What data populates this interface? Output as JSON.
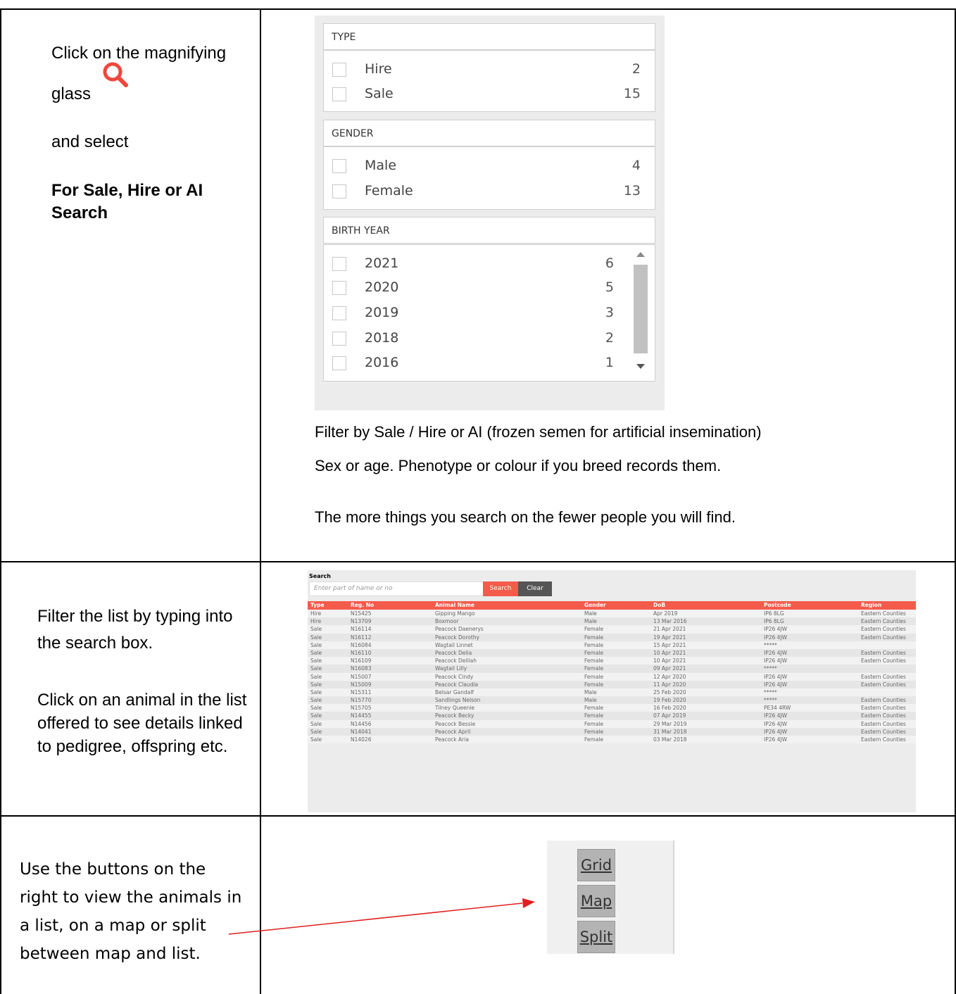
{
  "row1": {
    "instruction_1": "Click on the magnifying",
    "instruction_2": "glass",
    "instruction_3": "and select",
    "instruction_4": "For Sale, Hire or AI",
    "instruction_5": "Search",
    "icon": "search-icon",
    "icon_color": "#f0463c"
  },
  "filter_panel": {
    "type": {
      "title": "TYPE",
      "options": [
        {
          "label": "Hire",
          "count": "2"
        },
        {
          "label": "Sale",
          "count": "15"
        }
      ]
    },
    "gender": {
      "title": "GENDER",
      "options": [
        {
          "label": "Male",
          "count": "4"
        },
        {
          "label": "Female",
          "count": "13"
        }
      ]
    },
    "birth_year": {
      "title": "BIRTH YEAR",
      "options": [
        {
          "label": "2021",
          "count": "6"
        },
        {
          "label": "2020",
          "count": "5"
        },
        {
          "label": "2019",
          "count": "3"
        },
        {
          "label": "2018",
          "count": "2"
        },
        {
          "label": "2016",
          "count": "1"
        }
      ]
    }
  },
  "notes": {
    "line1": "Filter by Sale / Hire or AI (frozen semen for artificial insemination)",
    "line2": "Sex or age. Phenotype or colour if you breed records them.",
    "line3": "The more things you search on the fewer people you will find."
  },
  "row2": {
    "text1a": "Filter the list by typing into",
    "text1b": "the search box.",
    "text2a": "Click on an animal in the list",
    "text2b": "offered to see details linked",
    "text2c": "to pedigree, offspring etc."
  },
  "search": {
    "label": "Search",
    "placeholder": "Enter part of name or no",
    "search_button": "Search",
    "clear_button": "Clear",
    "accent": "#f45b4b"
  },
  "grid": {
    "columns": [
      "Type",
      "Reg. No",
      "Animal Name",
      "Gender",
      "DoB",
      "Postcode",
      "Region"
    ],
    "rows": [
      [
        "Hire",
        "N15425",
        "Gipping Mango",
        "Male",
        "Apr 2019",
        "IP6 8LG",
        "Eastern Counties"
      ],
      [
        "Hire",
        "N13709",
        "Boxmoor",
        "Male",
        "13 Mar 2016",
        "IP6 8LG",
        "Eastern Counties"
      ],
      [
        "Sale",
        "N16114",
        "Peacock Daenerys",
        "Female",
        "21 Apr 2021",
        "IP26 4JW",
        "Eastern Counties"
      ],
      [
        "Sale",
        "N16112",
        "Peacock Dorothy",
        "Female",
        "19 Apr 2021",
        "IP26 4JW",
        "Eastern Counties"
      ],
      [
        "Sale",
        "N16084",
        "Wagtail Linnet",
        "Female",
        "15 Apr 2021",
        "*****",
        ""
      ],
      [
        "Sale",
        "N16110",
        "Peacock Delia",
        "Female",
        "10 Apr 2021",
        "IP26 4JW",
        "Eastern Counties"
      ],
      [
        "Sale",
        "N16109",
        "Peacock Delilah",
        "Female",
        "10 Apr 2021",
        "IP26 4JW",
        "Eastern Counties"
      ],
      [
        "Sale",
        "N16083",
        "Wagtail Lilly",
        "Female",
        "09 Apr 2021",
        "*****",
        ""
      ],
      [
        "Sale",
        "N15007",
        "Peacock Cindy",
        "Female",
        "12 Apr 2020",
        "IP26 4JW",
        "Eastern Counties"
      ],
      [
        "Sale",
        "N15009",
        "Peacock Claudia",
        "Female",
        "11 Apr 2020",
        "IP26 4JW",
        "Eastern Counties"
      ],
      [
        "Sale",
        "N15311",
        "Belsar Gandalf",
        "Male",
        "25 Feb 2020",
        "*****",
        ""
      ],
      [
        "Sale",
        "N15770",
        "Sandlings Nelson",
        "Male",
        "19 Feb 2020",
        "*****",
        "Eastern Counties"
      ],
      [
        "Sale",
        "N15705",
        "Tilney Queenie",
        "Female",
        "16 Feb 2020",
        "PE34 4RW",
        "Eastern Counties"
      ],
      [
        "Sale",
        "N14455",
        "Peacock Becky",
        "Female",
        "07 Apr 2019",
        "IP26 4JW",
        "Eastern Counties"
      ],
      [
        "Sale",
        "N14456",
        "Peacock Bessie",
        "Female",
        "29 Mar 2019",
        "IP26 4JW",
        "Eastern Counties"
      ],
      [
        "Sale",
        "N14041",
        "Peacock April",
        "Female",
        "31 Mar 2018",
        "IP26 4JW",
        "Eastern Counties"
      ],
      [
        "Sale",
        "N14026",
        "Peacock Aria",
        "Female",
        "03 Mar 2018",
        "IP26 4JW",
        "Eastern Counties"
      ]
    ]
  },
  "row3": {
    "text1": "Use the buttons on the",
    "text2": "right to view the animals in",
    "text3": "a list, on a map or split",
    "text4": "between map and list.",
    "arrow_color": "#e02020"
  },
  "view_buttons": {
    "grid": "Grid",
    "map": "Map",
    "split": "Split"
  }
}
